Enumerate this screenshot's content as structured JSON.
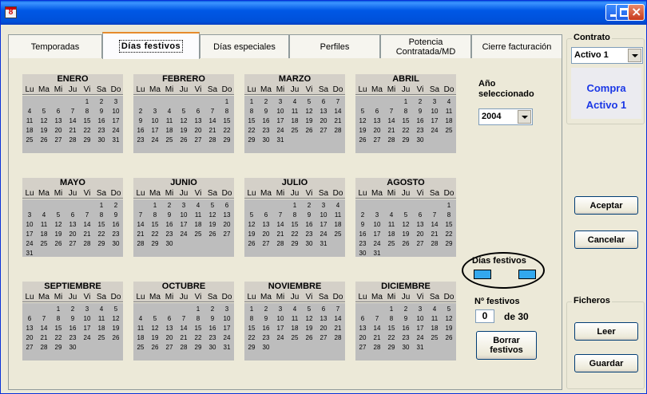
{
  "window": {
    "icon_text": "8"
  },
  "tabs": [
    {
      "label": "Temporadas"
    },
    {
      "label": "Días festivos"
    },
    {
      "label": "Días especiales"
    },
    {
      "label": "Perfiles"
    },
    {
      "label": "Potencia Contratada/MD"
    },
    {
      "label": "Cierre facturación"
    }
  ],
  "dow": [
    "Lu",
    "Ma",
    "Mi",
    "Ju",
    "Vi",
    "Sa",
    "Do"
  ],
  "months": [
    {
      "name": "ENERO",
      "start": 4,
      "days": 31
    },
    {
      "name": "FEBRERO",
      "start": 6,
      "days": 29
    },
    {
      "name": "MARZO",
      "start": 0,
      "days": 31
    },
    {
      "name": "ABRIL",
      "start": 3,
      "days": 30
    },
    {
      "name": "MAYO",
      "start": 5,
      "days": 31
    },
    {
      "name": "JUNIO",
      "start": 1,
      "days": 30
    },
    {
      "name": "JULIO",
      "start": 3,
      "days": 31
    },
    {
      "name": "AGOSTO",
      "start": 6,
      "days": 31
    },
    {
      "name": "SEPTIEMBRE",
      "start": 2,
      "days": 30
    },
    {
      "name": "OCTUBRE",
      "start": 4,
      "days": 31
    },
    {
      "name": "NOVIEMBRE",
      "start": 0,
      "days": 30
    },
    {
      "name": "DICIEMBRE",
      "start": 2,
      "days": 31
    }
  ],
  "year": {
    "label_line1": "Año",
    "label_line2": "seleccionado",
    "value": "2004"
  },
  "legend": {
    "label": "Días festivos",
    "color": "#33a8ee"
  },
  "holidays": {
    "label": "Nº festivos",
    "count": "0",
    "total_text": "de 30"
  },
  "borrar_button": {
    "line1": "Borrar",
    "line2": "festivos"
  },
  "contrato": {
    "legend": "Contrato",
    "selected": "Activo 1",
    "compra": "Compra",
    "active": "Activo 1"
  },
  "buttons": {
    "aceptar": "Aceptar",
    "cancelar": "Cancelar",
    "leer": "Leer",
    "guardar": "Guardar"
  },
  "ficheros": {
    "legend": "Ficheros"
  }
}
